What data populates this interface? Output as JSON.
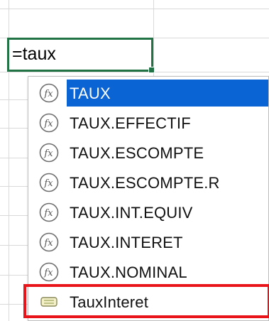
{
  "cell": {
    "formula": "=taux"
  },
  "autocomplete": {
    "items": [
      {
        "label": "TAUX",
        "icon": "function-icon",
        "selected": true
      },
      {
        "label": "TAUX.EFFECTIF",
        "icon": "function-icon"
      },
      {
        "label": "TAUX.ESCOMPTE",
        "icon": "function-icon"
      },
      {
        "label": "TAUX.ESCOMPTE.R",
        "icon": "function-icon"
      },
      {
        "label": "TAUX.INT.EQUIV",
        "icon": "function-icon"
      },
      {
        "label": "TAUX.INTERET",
        "icon": "function-icon"
      },
      {
        "label": "TAUX.NOMINAL",
        "icon": "function-icon"
      },
      {
        "label": "TauxInteret",
        "icon": "named-range-icon",
        "highlighted": true
      }
    ]
  },
  "colors": {
    "cell_border": "#217346",
    "selection": "#0a64d4",
    "highlight_box": "#e8141a"
  }
}
